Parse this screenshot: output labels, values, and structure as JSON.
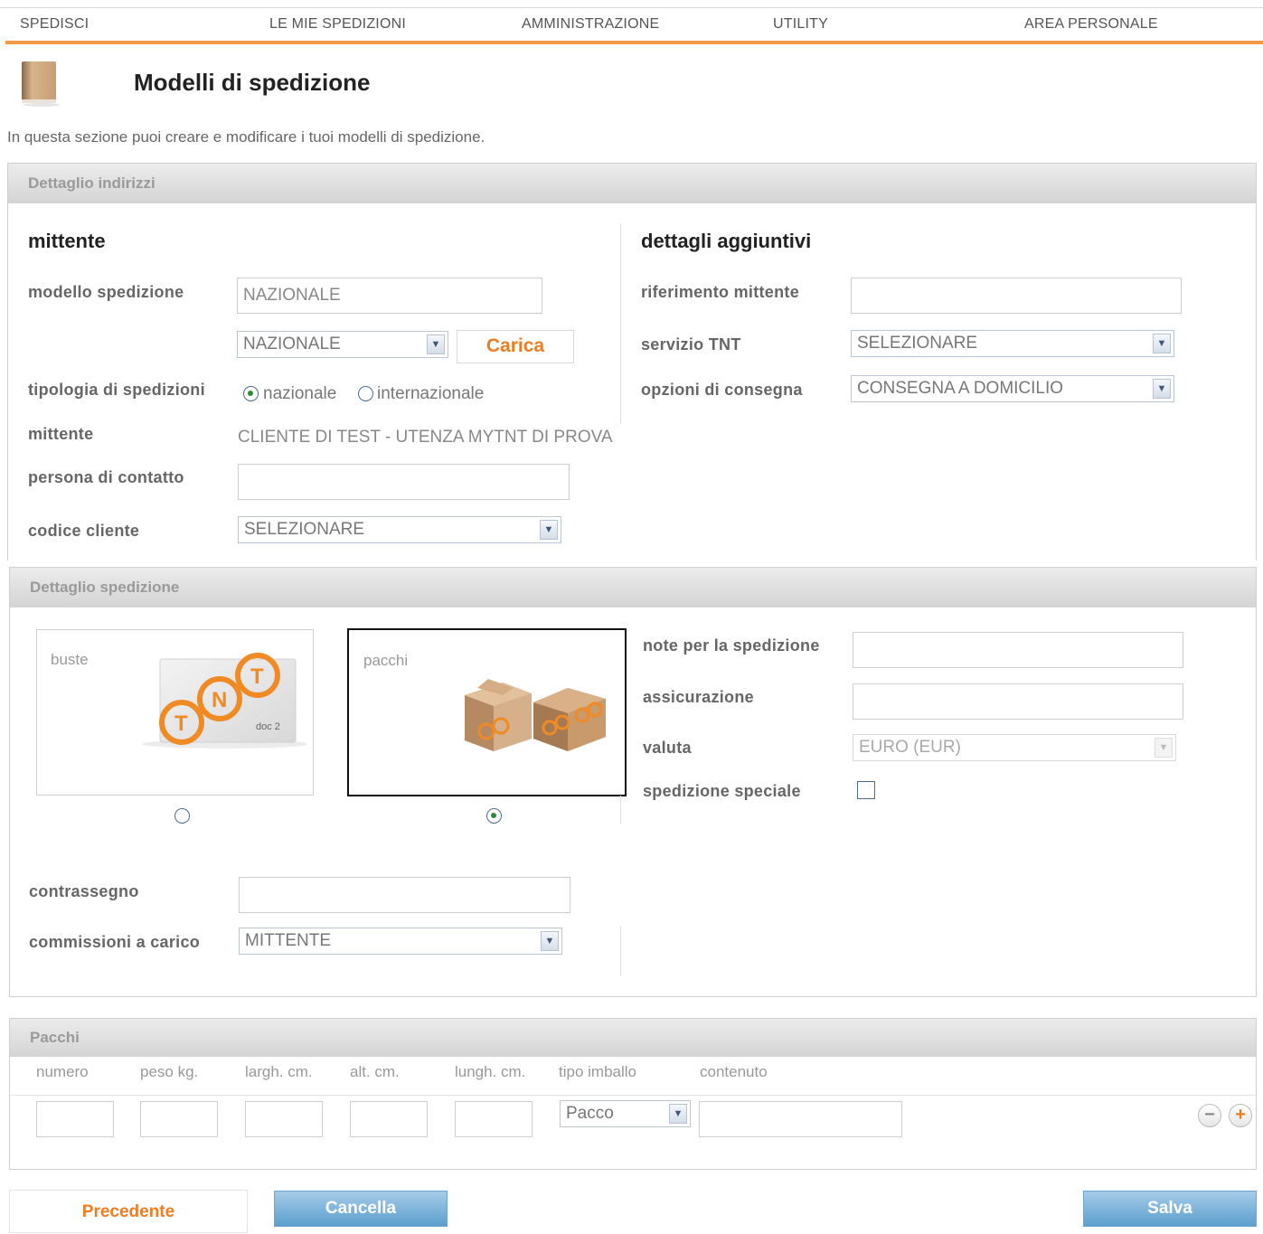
{
  "nav": {
    "items": [
      "SPEDISCI",
      "LE MIE SPEDIZIONI",
      "AMMINISTRAZIONE",
      "UTILITY",
      "AREA PERSONALE"
    ]
  },
  "header": {
    "title": "Modelli di spedizione",
    "description": "In questa sezione puoi creare e modificare i tuoi modelli di spedizione."
  },
  "addresses": {
    "section_title": "Dettaglio indirizzi",
    "mittente_heading": "mittente",
    "modello_label": "modello spedizione",
    "modello_value": "NAZIONALE",
    "modello_select": "NAZIONALE",
    "carica_label": "Carica",
    "tipologia_label": "tipologia di spedizioni",
    "radio_nazionale": "nazionale",
    "radio_internazionale": "internazionale",
    "mittente_label": "mittente",
    "mittente_value": "CLIENTE DI TEST - UTENZA MYTNT DI PROVA",
    "contatto_label": "persona di contatto",
    "contatto_value": "",
    "codice_label": "codice cliente",
    "codice_select": "SELEZIONARE",
    "extra_heading": "dettagli aggiuntivi",
    "riferimento_label": "riferimento mittente",
    "riferimento_value": "",
    "servizio_label": "servizio TNT",
    "servizio_select": "SELEZIONARE",
    "opzioni_label": "opzioni di consegna",
    "opzioni_select": "CONSEGNA A DOMICILIO"
  },
  "shipment": {
    "section_title": "Dettaglio spedizione",
    "buste_label": "buste",
    "pacchi_label": "pacchi",
    "note_label": "note per la spedizione",
    "note_value": "",
    "assicurazione_label": "assicurazione",
    "assicurazione_value": "",
    "valuta_label": "valuta",
    "valuta_select": "EURO (EUR)",
    "speciale_label": "spedizione speciale",
    "contrassegno_label": "contrassegno",
    "contrassegno_value": "",
    "commissioni_label": "commissioni a carico",
    "commissioni_select": "MITTENTE",
    "buste_logo_letters": [
      "T",
      "N",
      "T"
    ],
    "buste_logo_text": "doc 2"
  },
  "packages": {
    "section_title": "Pacchi",
    "columns": [
      "numero",
      "peso kg.",
      "largh. cm.",
      "alt. cm.",
      "lungh. cm.",
      "tipo imballo",
      "contenuto"
    ],
    "tipo_select": "Pacco",
    "remove_symbol": "−",
    "add_symbol": "+"
  },
  "footer": {
    "prev_label": "Precedente",
    "cancel_label": "Cancella",
    "save_label": "Salva"
  },
  "colors": {
    "accent": "#f39a44",
    "button_orange_text": "#f07c22",
    "button_blue": "#5b9fce"
  }
}
